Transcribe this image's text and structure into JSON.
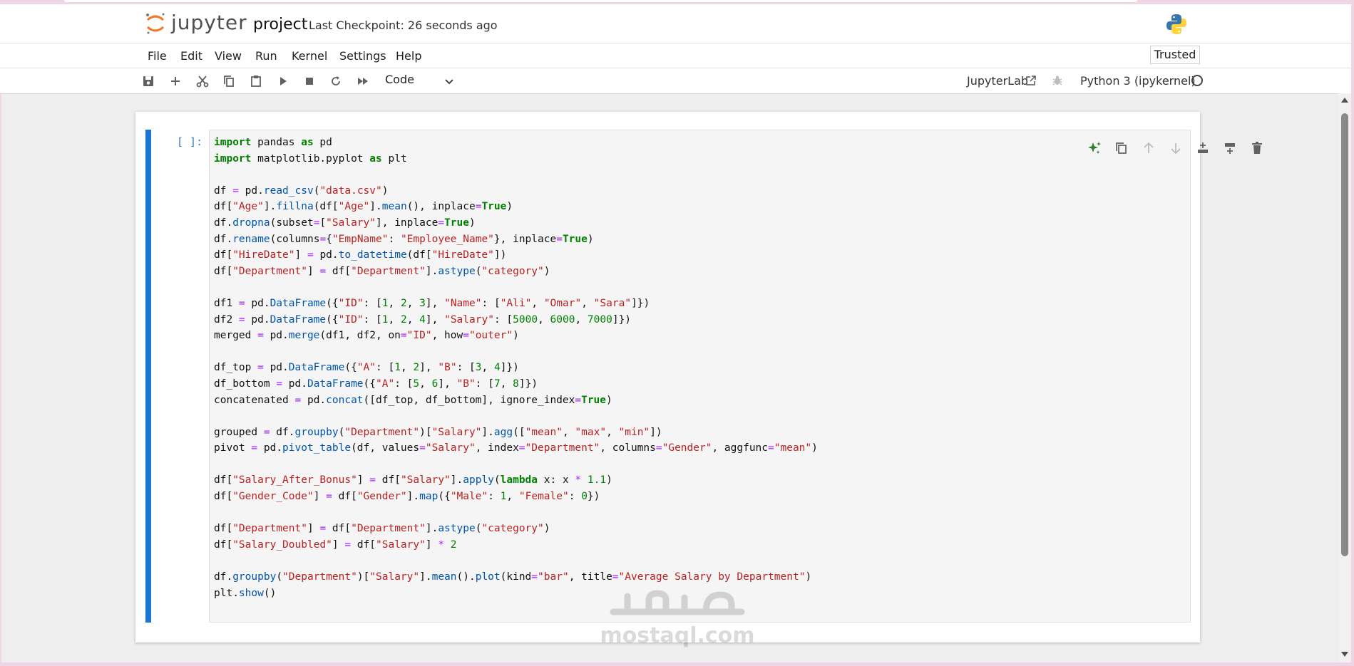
{
  "header": {
    "logo_text": "jupyter",
    "notebook_name": "project",
    "checkpoint": "Last Checkpoint: 26 seconds ago"
  },
  "menu": {
    "items": [
      "File",
      "Edit",
      "View",
      "Run",
      "Kernel",
      "Settings",
      "Help"
    ],
    "trusted": "Trusted"
  },
  "toolbar": {
    "icons": [
      "save-icon",
      "add-cell-icon",
      "cut-icon",
      "copy-icon",
      "paste-icon",
      "run-icon",
      "stop-icon",
      "restart-icon",
      "fast-forward-icon"
    ],
    "cell_type": "Code",
    "jupyterlab_link": "JupyterLab",
    "kernel": "Python 3 (ipykernel)"
  },
  "cell": {
    "prompt": "[ ]:",
    "toolbar_icons": [
      "ai-sparkle-icon",
      "duplicate-icon",
      "move-up-icon",
      "move-down-icon",
      "insert-above-icon",
      "insert-below-icon",
      "delete-icon"
    ],
    "code_lines": [
      "import pandas as pd",
      "import matplotlib.pyplot as plt",
      "",
      "df = pd.read_csv(\"data.csv\")",
      "df[\"Age\"].fillna(df[\"Age\"].mean(), inplace=True)",
      "df.dropna(subset=[\"Salary\"], inplace=True)",
      "df.rename(columns={\"EmpName\": \"Employee_Name\"}, inplace=True)",
      "df[\"HireDate\"] = pd.to_datetime(df[\"HireDate\"])",
      "df[\"Department\"] = df[\"Department\"].astype(\"category\")",
      "",
      "df1 = pd.DataFrame({\"ID\": [1, 2, 3], \"Name\": [\"Ali\", \"Omar\", \"Sara\"]})",
      "df2 = pd.DataFrame({\"ID\": [1, 2, 4], \"Salary\": [5000, 6000, 7000]})",
      "merged = pd.merge(df1, df2, on=\"ID\", how=\"outer\")",
      "",
      "df_top = pd.DataFrame({\"A\": [1, 2], \"B\": [3, 4]})",
      "df_bottom = pd.DataFrame({\"A\": [5, 6], \"B\": [7, 8]})",
      "concatenated = pd.concat([df_top, df_bottom], ignore_index=True)",
      "",
      "grouped = df.groupby(\"Department\")[\"Salary\"].agg([\"mean\", \"max\", \"min\"])",
      "pivot = pd.pivot_table(df, values=\"Salary\", index=\"Department\", columns=\"Gender\", aggfunc=\"mean\")",
      "",
      "df[\"Salary_After_Bonus\"] = df[\"Salary\"].apply(lambda x: x * 1.1)",
      "df[\"Gender_Code\"] = df[\"Gender\"].map({\"Male\": 1, \"Female\": 0})",
      "",
      "df[\"Department\"] = df[\"Department\"].astype(\"category\")",
      "df[\"Salary_Doubled\"] = df[\"Salary\"] * 2",
      "",
      "df.groupby(\"Department\")[\"Salary\"].mean().plot(kind=\"bar\", title=\"Average Salary by Department\")",
      "plt.show()"
    ]
  },
  "watermark": {
    "text": "mostaql.com"
  },
  "colors": {
    "accent": "#1976d2",
    "keyword": "#008000",
    "string": "#ba2121",
    "function": "#0055aa"
  }
}
